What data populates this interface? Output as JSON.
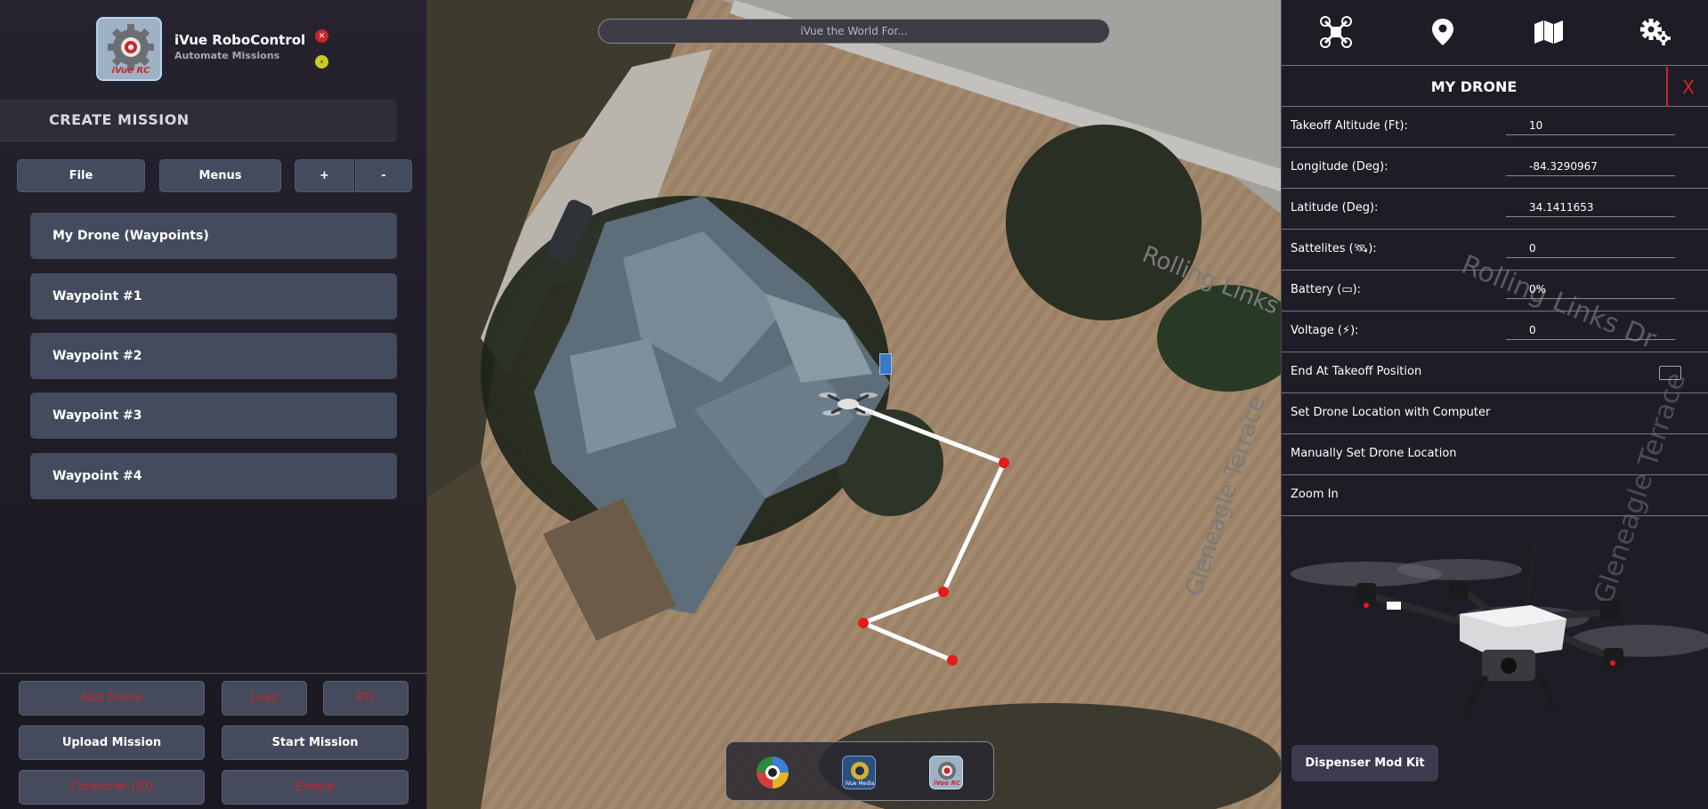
{
  "app": {
    "title": "iVue RoboControl",
    "subtitle": "Automate Missions",
    "logo_text": "iVue RC"
  },
  "left_panel": {
    "create_mission": "CREATE MISSION",
    "toolbar": {
      "file": "File",
      "menus": "Menus",
      "plus": "+",
      "minus": "-"
    },
    "mission_items": [
      "My Drone (Waypoints)",
      "Waypoint #1",
      "Waypoint #2",
      "Waypoint #3",
      "Waypoint #4"
    ],
    "bottom_buttons": {
      "row1": [
        "Add Drone",
        "Load",
        "RTL"
      ],
      "row2": [
        "Upload Mission",
        "Start Mission"
      ],
      "row3": [
        "Controller (ID)",
        "Enable"
      ]
    }
  },
  "map": {
    "search_placeholder": "iVue the World For...",
    "street_labels": [
      "Rolling Links Dr",
      "Gleneagle Terrace"
    ],
    "dock_apps": [
      "camera-app-icon",
      "ivue-media-icon",
      "ivue-rc-icon"
    ],
    "dock_labels": {
      "media": "iVue Media",
      "rc": "iVue RC"
    }
  },
  "right_panel": {
    "top_icons": [
      "drone-icon",
      "location-pin-icon",
      "map-icon",
      "settings-gears-icon"
    ],
    "title": "MY DRONE",
    "close": "X",
    "fields": [
      {
        "label": "Takeoff Altitude (Ft):",
        "value": "10"
      },
      {
        "label": "Longitude (Deg):",
        "value": "-84.3290967"
      },
      {
        "label": "Latitude (Deg):",
        "value": "34.1411653"
      },
      {
        "label": "Sattelites (🛰):",
        "value": "0"
      },
      {
        "label": "Battery (▭):",
        "value": "0%"
      },
      {
        "label": "Voltage (⚡):",
        "value": "0"
      }
    ],
    "options": [
      "End At Takeoff Position",
      "Set Drone Location with Computer",
      "Manually Set Drone Location",
      "Zoom In"
    ],
    "end_at_takeoff_checked": false,
    "kit_button": "Dispenser Mod Kit"
  },
  "colors": {
    "accent_red": "#c52a2a",
    "button_bg": "#444b5f",
    "panel_bg": "#1e1c24",
    "waypoint_marker": "#e31b1b"
  }
}
